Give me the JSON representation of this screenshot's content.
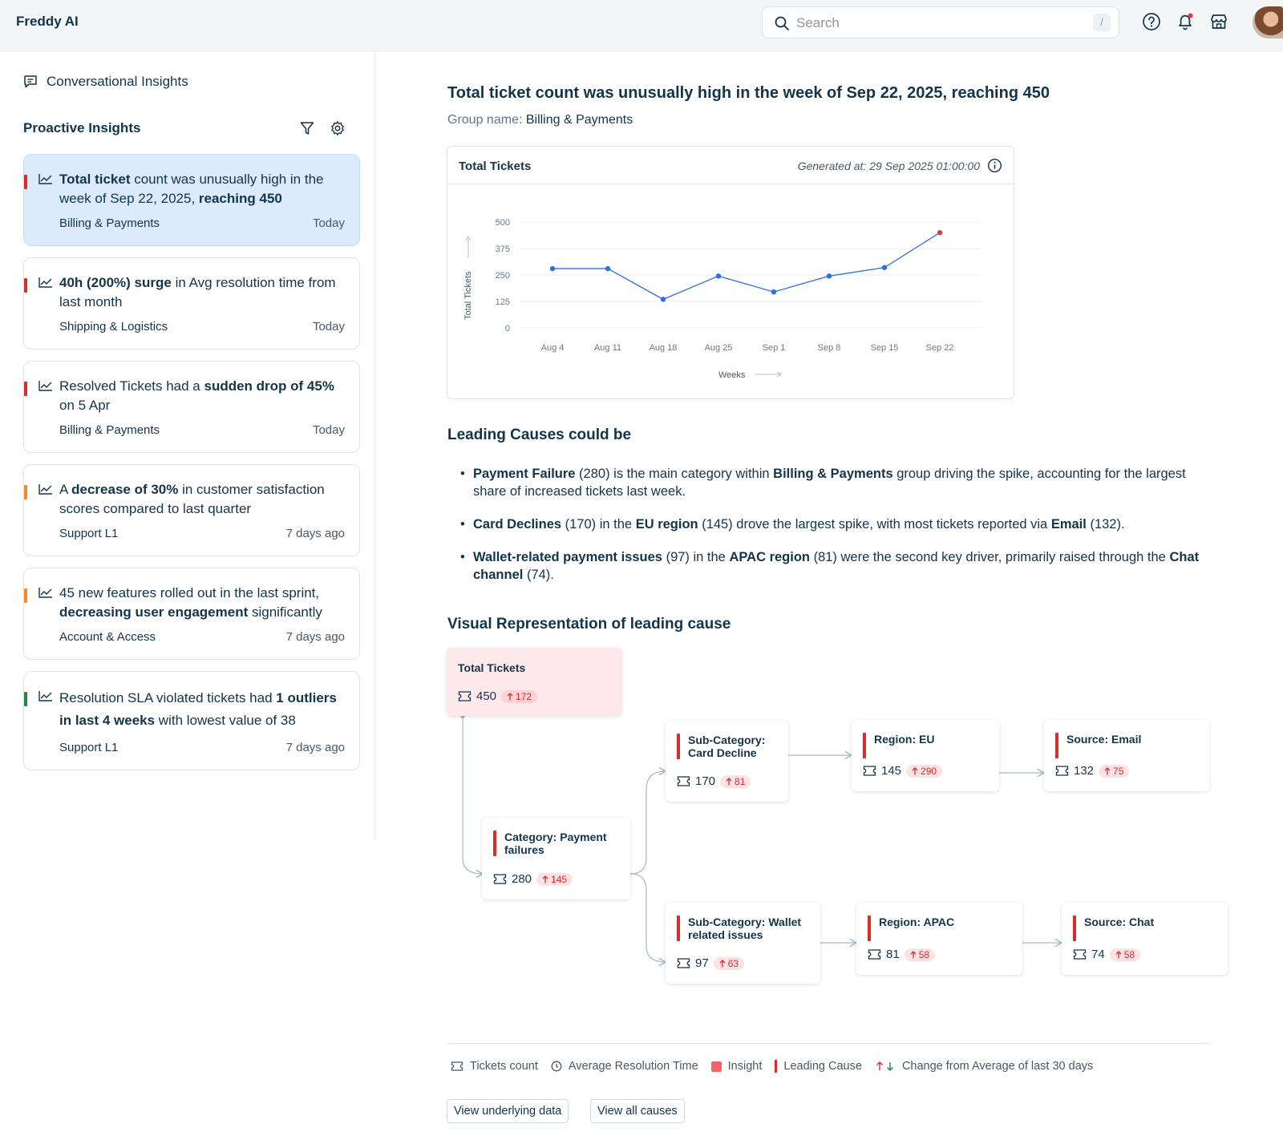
{
  "app": {
    "title": "Freddy AI"
  },
  "search": {
    "placeholder": "Search",
    "shortcut": "/"
  },
  "topbar_icons": [
    "help-icon",
    "bell-icon",
    "store-icon"
  ],
  "sidebar": {
    "conversational_label": "Conversational Insights",
    "proactive_title": "Proactive Insights",
    "cards": [
      {
        "parts": [
          {
            "t": "Total ticket",
            "b": true
          },
          {
            "t": " count was unusually high in the week of Sep 22, 2025, "
          },
          {
            "t": "reaching 450",
            "b": true
          }
        ],
        "group": "Billing & Payments",
        "time": "Today",
        "color": "#d72d2d",
        "active": true
      },
      {
        "parts": [
          {
            "t": "40h (200%) surge",
            "b": true
          },
          {
            "t": " in Avg resolution time from last month"
          }
        ],
        "group": "Shipping & Logistics",
        "time": "Today",
        "color": "#d72d2d"
      },
      {
        "parts": [
          {
            "t": "Resolved Tickets had a "
          },
          {
            "t": "sudden drop of 45%",
            "b": true
          },
          {
            "t": " on 5 Apr"
          }
        ],
        "group": "Billing & Payments",
        "time": "Today",
        "color": "#d72d2d"
      },
      {
        "parts": [
          {
            "t": "A "
          },
          {
            "t": "decrease of 30%",
            "b": true
          },
          {
            "t": " in customer satisfaction scores compared to last quarter"
          }
        ],
        "group": "Support L1",
        "time": "7 days ago",
        "color": "#f08a24"
      },
      {
        "parts": [
          {
            "t": "45 new features rolled out in the last sprint, "
          },
          {
            "t": "decreasing user engagement",
            "b": true
          },
          {
            "t": " significantly"
          }
        ],
        "group": "Account & Access",
        "time": "7 days ago",
        "color": "#f08a24"
      },
      {
        "parts": [
          {
            "t": "Resolution SLA violated tickets had "
          },
          {
            "t": "1 outliers in last 4 weeks",
            "b": true
          },
          {
            "t": " with lowest value of 38"
          }
        ],
        "group": "Support L1",
        "time": "7 days ago",
        "color": "#1e8a4c"
      }
    ]
  },
  "main": {
    "title": "Total ticket count was unusually high in the week of Sep 22, 2025, reaching 450",
    "group_label": "Group name:",
    "group_value": "Billing & Payments",
    "chart_title": "Total Tickets",
    "generated": "Generated at: 29 Sep 2025 01:00:00",
    "causes_title": "Leading Causes could be",
    "causes": [
      [
        {
          "t": "Payment Failure",
          "b": true
        },
        {
          "t": " (280) is the main category within "
        },
        {
          "t": "Billing & Payments",
          "b": true
        },
        {
          "t": " group driving the spike, accounting for the largest share of increased tickets last week."
        }
      ],
      [
        {
          "t": "Card Declines",
          "b": true
        },
        {
          "t": " (170) in the "
        },
        {
          "t": "EU region",
          "b": true
        },
        {
          "t": " (145) drove the largest spike, with most tickets reported via "
        },
        {
          "t": "Email",
          "b": true
        },
        {
          "t": " (132)."
        }
      ],
      [
        {
          "t": "Wallet-related payment issues",
          "b": true
        },
        {
          "t": " (97) in the "
        },
        {
          "t": "APAC region",
          "b": true
        },
        {
          "t": " (81) were the second key driver, primarily raised through the "
        },
        {
          "t": "Chat channel",
          "b": true
        },
        {
          "t": " (74)."
        }
      ]
    ],
    "visual_title": "Visual Representation of leading cause",
    "flow": {
      "insight": {
        "title": "Total Tickets",
        "count": "450",
        "change": "172"
      },
      "category": {
        "title": "Category: Payment failures",
        "count": "280",
        "change": "145"
      },
      "sub1": {
        "title": "Sub-Category: Card Decline",
        "count": "170",
        "change": "81"
      },
      "region1": {
        "title": "Region: EU",
        "count": "145",
        "change": "290"
      },
      "source1": {
        "title": "Source: Email",
        "count": "132",
        "change": "75"
      },
      "sub2": {
        "title": "Sub-Category: Wallet related issues",
        "count": "97",
        "change": "63"
      },
      "region2": {
        "title": "Region: APAC",
        "count": "81",
        "change": "58"
      },
      "source2": {
        "title": "Source: Chat",
        "count": "74",
        "change": "58"
      }
    },
    "legend": {
      "tickets": "Tickets count",
      "resolution": "Average Resolution Time",
      "insight": "Insight",
      "leading": "Leading Cause",
      "change": "Change from Average of last 30 days"
    },
    "buttons": {
      "underlying": "View underlying data",
      "all_causes": "View all causes"
    }
  },
  "chart_data": {
    "type": "line",
    "title": "Total Tickets",
    "xlabel": "Weeks",
    "ylabel": "Total Tickets",
    "categories": [
      "Aug 4",
      "Aug 11",
      "Aug 18",
      "Aug 25",
      "Sep 1",
      "Sep 8",
      "Sep 15",
      "Sep 22"
    ],
    "series": [
      {
        "values": [
          280,
          280,
          135,
          245,
          170,
          245,
          285,
          450
        ]
      }
    ],
    "y_ticks": [
      0,
      125,
      250,
      375,
      500
    ],
    "ylim": [
      0,
      500
    ],
    "grid": true,
    "highlight_last": true,
    "colors": {
      "line": "#2f6fe4",
      "highlight": "#e43838"
    }
  },
  "colors": {
    "accent_red": "#d72d2d",
    "orange": "#f08a24",
    "green": "#1e8a4c",
    "active_card": "#dcebfb"
  }
}
